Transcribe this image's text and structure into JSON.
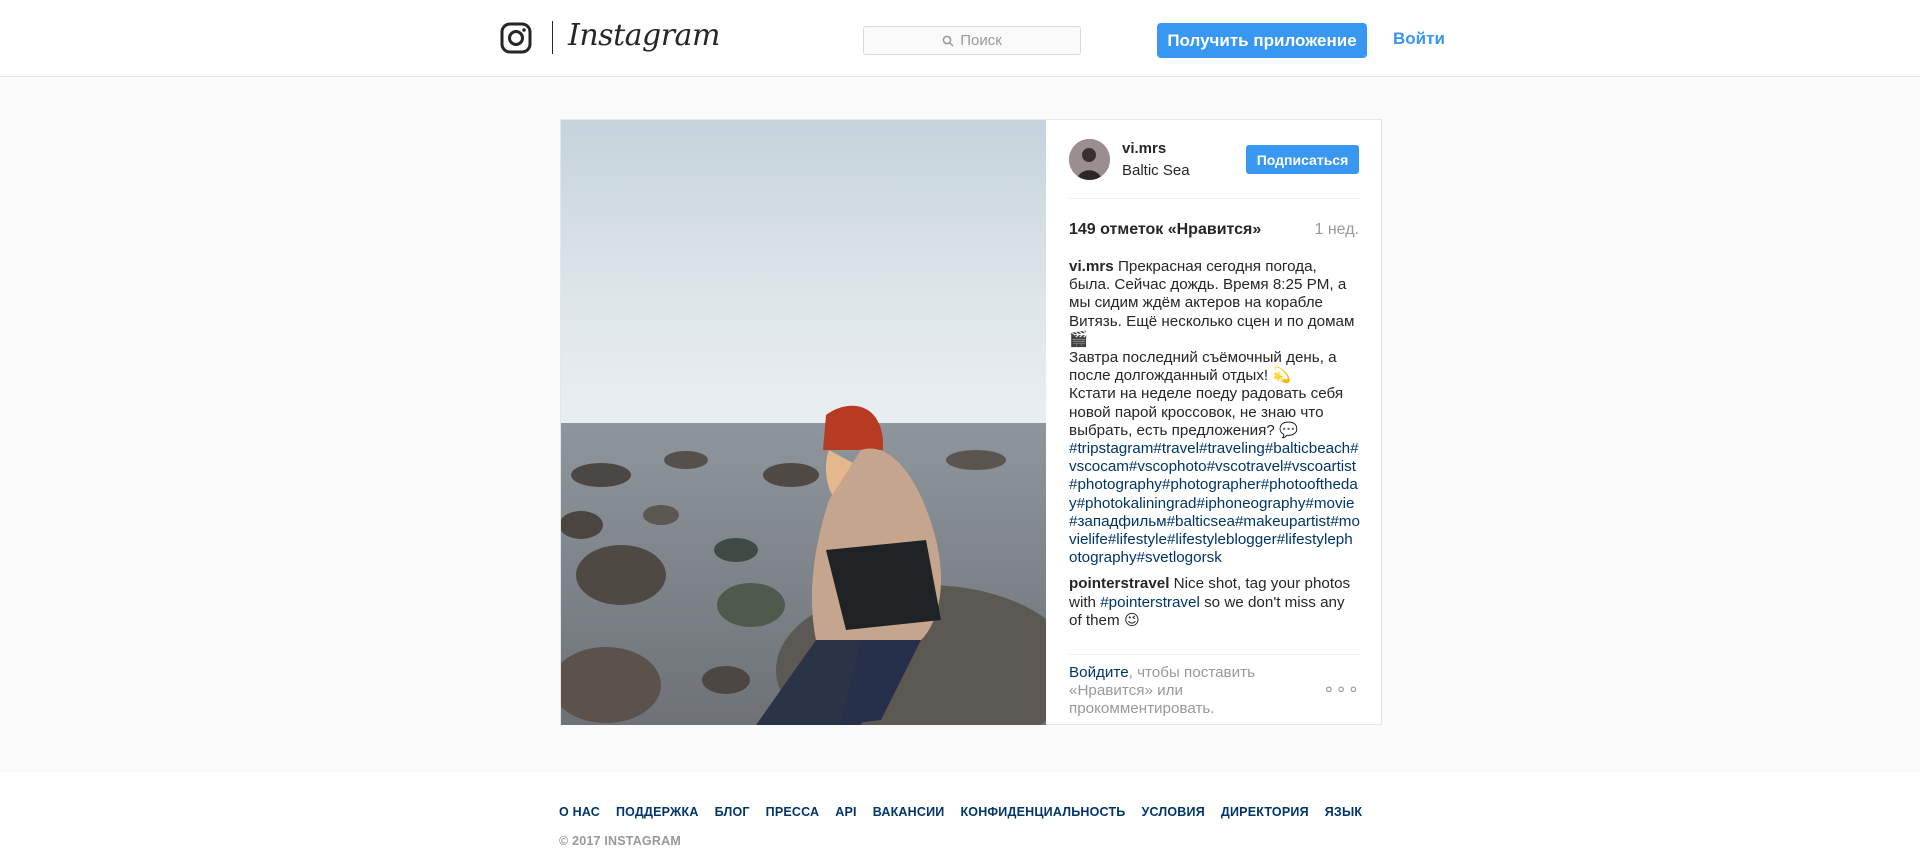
{
  "header": {
    "wordmark": "Instagram",
    "search_placeholder": "Поиск",
    "get_app_label": "Получить приложение",
    "login_label": "Войти"
  },
  "post": {
    "author": "vi.mrs",
    "location": "Baltic Sea",
    "follow_label": "Подписаться",
    "likes": "149 отметок «Нравится»",
    "time_ago": "1 нед.",
    "caption_user": "vi.mrs",
    "caption_text": " Прекрасная сегодня погода, была. Сейчас дождь. Время 8:25 PM, а мы сидим ждём актеров на корабле Витязь. Ещё несколько сцен и по домам🎬\nЗавтра последний съёмочный день, а после долгожданный отдых! 💫\nКстати на неделе поеду радовать себя новой парой кроссовок, не знаю что выбрать, есть предложения? 💬\n",
    "caption_hashtags": "#tripstagram#travel#traveling#balticbeach#vscocam#vscophoto#vscotravel#vscoartist#photography#photographer#photooftheday#photokaliningrad#iphoneography#movie#западфильм#balticsea#makeupartist#movielife#lifestyle#lifestyleblogger#lifestylephotography#svetlogorsk",
    "comment_user": "pointerstravel",
    "comment_text_1": " Nice shot, tag your photos with ",
    "comment_tag": "#pointerstravel",
    "comment_text_2": " so we don't miss any of them 😉",
    "login_prompt_link": "Войдите",
    "login_prompt_text": ", чтобы поставить «Нравится» или прокомментировать.",
    "more_label": "∘∘∘"
  },
  "footer": {
    "links": [
      "О НАС",
      "ПОДДЕРЖКА",
      "БЛОГ",
      "ПРЕССА",
      "API",
      "ВАКАНСИИ",
      "КОНФИДЕНЦИАЛЬНОСТЬ",
      "УСЛОВИЯ",
      "ДИРЕКТОРИЯ",
      "ЯЗЫК"
    ],
    "copyright": "© 2017 INSTAGRAM"
  },
  "colors": {
    "accent": "#3897f0",
    "link": "#003569",
    "muted": "#999999"
  },
  "icons": {
    "logo": "instagram-camera-icon",
    "search": "magnifier-icon",
    "more": "more-options-icon"
  }
}
